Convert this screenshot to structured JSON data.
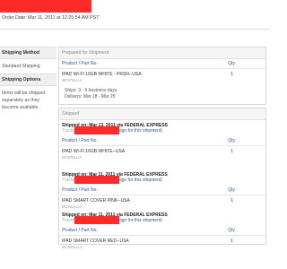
{
  "order_date": "Order Date: Mar 11, 2011 at 12:25:54 AM PST",
  "sidebar": {
    "shipping_method_title": "Shipping Method",
    "shipping_method_value": "Standard Shipping",
    "shipping_options_title": "Shipping Options",
    "shipping_options_text": "Items will be shipped separately as they become available."
  },
  "prepared": {
    "title": "Prepared for Shipment",
    "col_product": "Product / Part No.",
    "col_qty": "Qty",
    "item_name": "IPAD WI-FI 16GB WHITE - PRSN--USA",
    "item_code": "MC979LL/A",
    "item_qty": "1",
    "ships": "Ships: 3 - 5 business days",
    "delivers": "Delivers: Mar 18 - Mar 25"
  },
  "shipped": {
    "title": "Shipped",
    "shipments": [
      {
        "title": "Shipped on: Mar 13, 2011 via FEDERAL EXPRESS",
        "tracking_label": "Tracking",
        "sign_in": "sign for this shipment)",
        "col_product": "Product / Part No.",
        "col_qty": "Qty",
        "item_name": "IPAD WI-FI 16GB WHITE--USA",
        "item_code": "MC979LL/A",
        "item_qty": "1"
      },
      {
        "title": "Shipped on: Mar 11, 2011 via FEDERAL EXPRESS",
        "tracking_label": "Tracking",
        "sign_in": "sign for this shipment)",
        "col_product": "Product / Part No.",
        "col_qty": "Qty",
        "item_name": "IPAD SMART COVER PINK--USA",
        "item_code": "MC941LL/A",
        "item_qty": "1"
      },
      {
        "title": "Shipped on: Mar 11, 2011 via FEDERAL EXPRESS",
        "tracking_label": "Tracking",
        "sign_in": "sign for this shipment)",
        "col_product": "Product / Part No.",
        "col_qty": "Qty",
        "item_name": "IPAD SMART COVER RED--USA",
        "item_code": "MC943LL/A",
        "item_qty": "1"
      }
    ]
  },
  "colors": {
    "redaction": "#ff2a2a",
    "link": "#2c5aa0"
  }
}
